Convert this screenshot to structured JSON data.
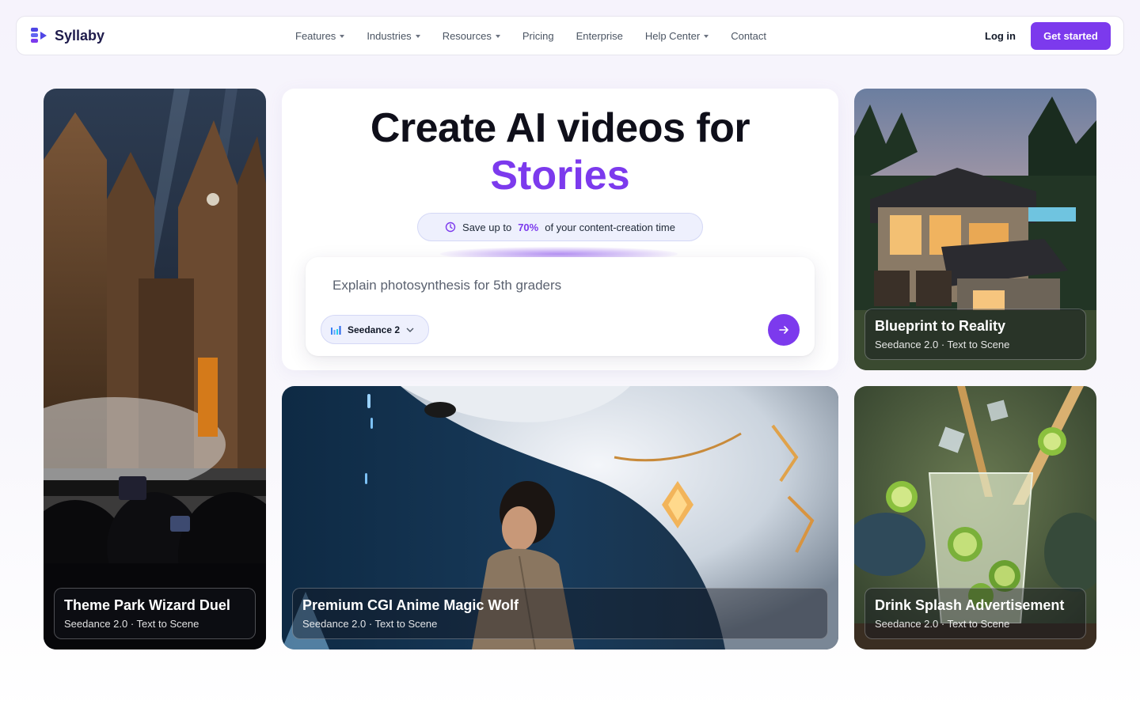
{
  "nav": {
    "brand": "Syllaby",
    "menu": [
      {
        "label": "Features",
        "dropdown": true
      },
      {
        "label": "Industries",
        "dropdown": true
      },
      {
        "label": "Resources",
        "dropdown": true
      },
      {
        "label": "Pricing",
        "dropdown": false
      },
      {
        "label": "Enterprise",
        "dropdown": false
      },
      {
        "label": "Help Center",
        "dropdown": true
      },
      {
        "label": "Contact",
        "dropdown": false
      }
    ],
    "login": "Log in",
    "cta": "Get started"
  },
  "hero": {
    "title_line1": "Create AI videos for",
    "title_line2": "Stories",
    "badge_prefix": "Save up to",
    "badge_highlight": "70%",
    "badge_suffix": "of your content-creation time",
    "prompt_placeholder": "Explain photosynthesis for 5th graders",
    "model_label": "Seedance 2"
  },
  "cards": [
    {
      "title": "Theme Park Wizard Duel",
      "subtitle": "Seedance 2.0 · Text to Scene"
    },
    {
      "title": "Blueprint to Reality",
      "subtitle": "Seedance 2.0 · Text to Scene"
    },
    {
      "title": "Premium CGI Anime Magic Wolf",
      "subtitle": "Seedance 2.0 · Text to Scene"
    },
    {
      "title": "Drink Splash Advertisement",
      "subtitle": "Seedance 2.0 · Text to Scene"
    }
  ],
  "colors": {
    "accent": "#7c3aed",
    "text": "#0f0f1a"
  }
}
